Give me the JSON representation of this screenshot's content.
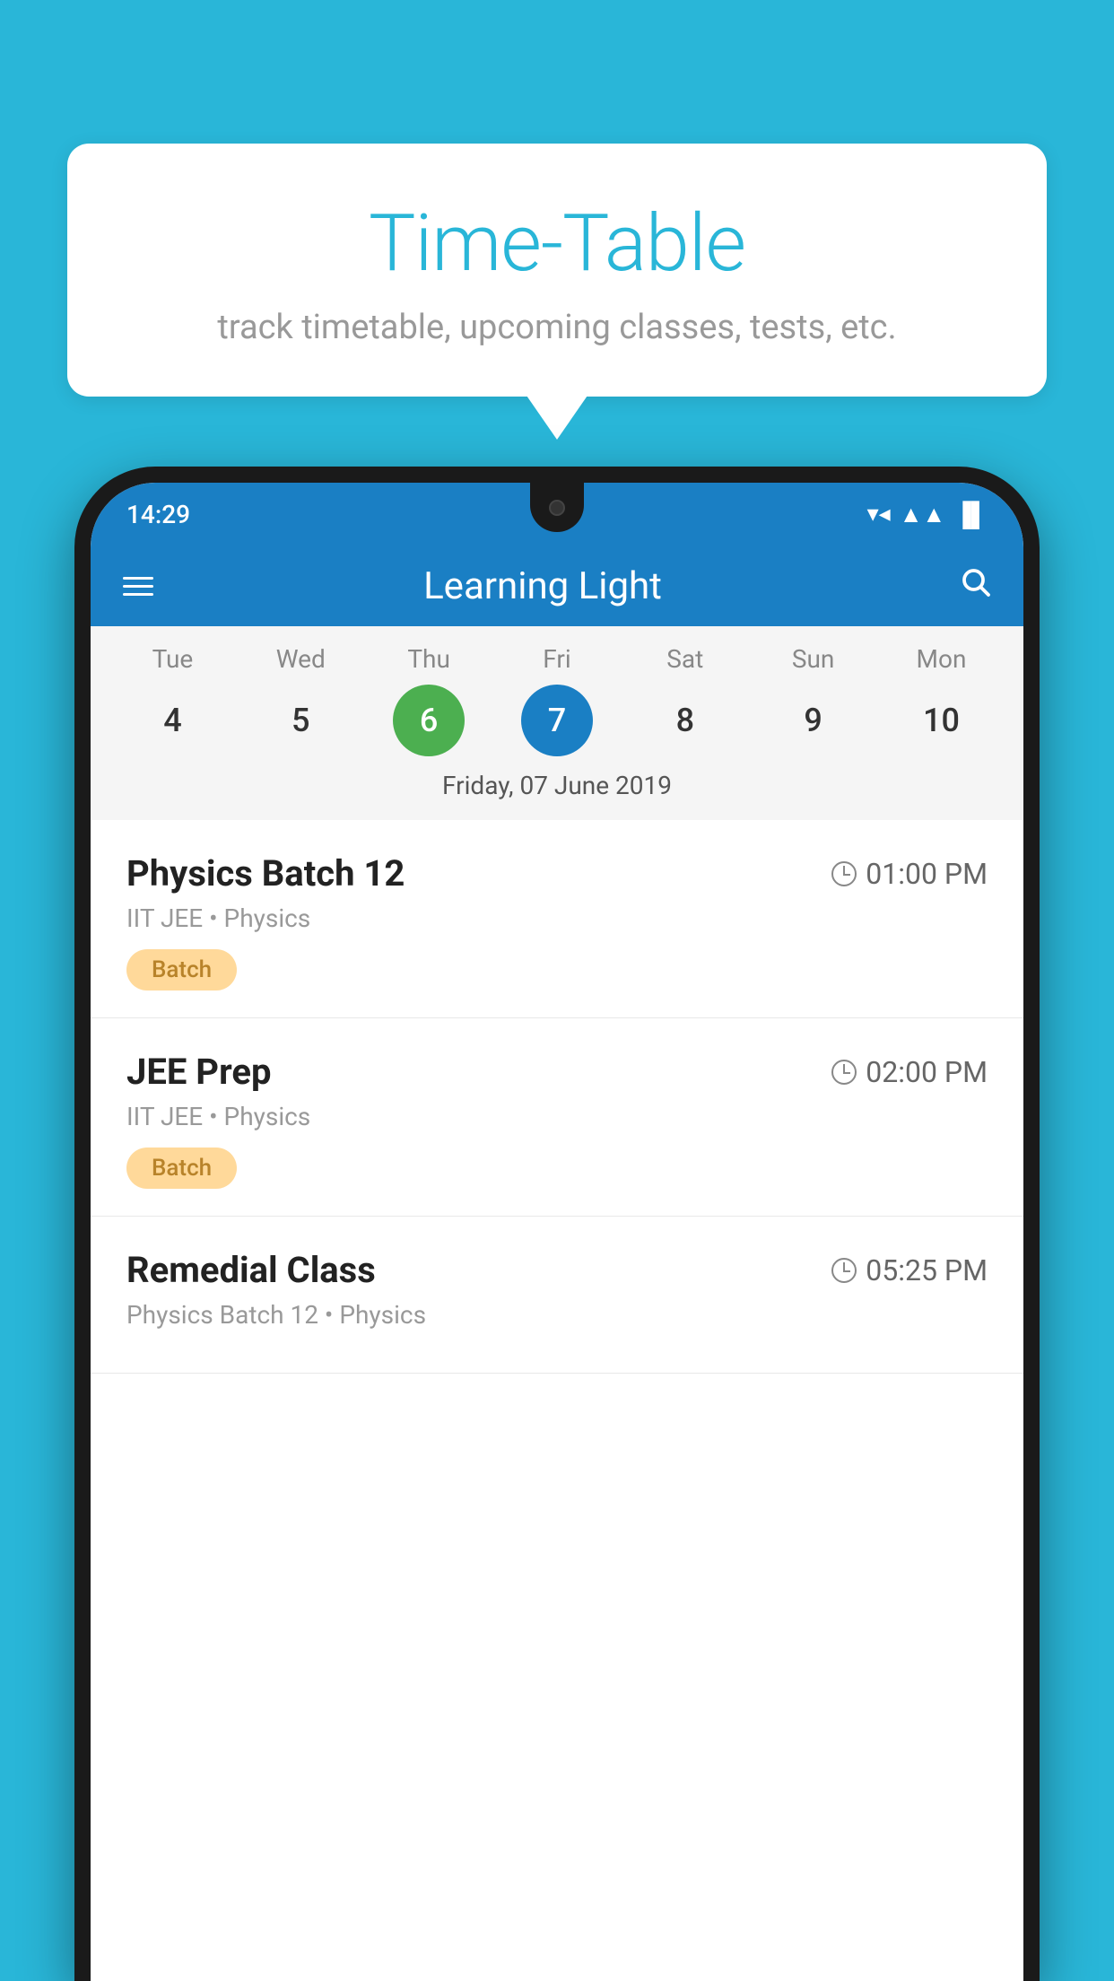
{
  "background_color": "#29b6d8",
  "speech_bubble": {
    "title": "Time-Table",
    "subtitle": "track timetable, upcoming classes, tests, etc."
  },
  "phone": {
    "status_bar": {
      "time": "14:29",
      "wifi": "▼▲",
      "signal": "▲",
      "battery": "▌"
    },
    "toolbar": {
      "title": "Learning Light",
      "hamburger_label": "menu",
      "search_label": "search"
    },
    "calendar": {
      "days": [
        {
          "label": "Tue",
          "num": "4"
        },
        {
          "label": "Wed",
          "num": "5"
        },
        {
          "label": "Thu",
          "num": "6",
          "state": "today"
        },
        {
          "label": "Fri",
          "num": "7",
          "state": "selected"
        },
        {
          "label": "Sat",
          "num": "8"
        },
        {
          "label": "Sun",
          "num": "9"
        },
        {
          "label": "Mon",
          "num": "10"
        }
      ],
      "selected_date": "Friday, 07 June 2019"
    },
    "schedule": [
      {
        "title": "Physics Batch 12",
        "time": "01:00 PM",
        "meta": "IIT JEE • Physics",
        "tag": "Batch"
      },
      {
        "title": "JEE Prep",
        "time": "02:00 PM",
        "meta": "IIT JEE • Physics",
        "tag": "Batch"
      },
      {
        "title": "Remedial Class",
        "time": "05:25 PM",
        "meta": "Physics Batch 12 • Physics",
        "tag": ""
      }
    ]
  }
}
